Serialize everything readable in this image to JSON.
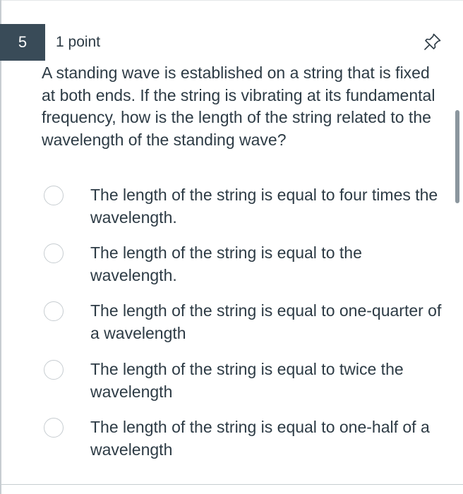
{
  "question": {
    "number": "5",
    "points": "1 point",
    "text": "A standing wave is established on a string that is fixed at both ends. If the string is vibrating at its fundamental frequency, how is the length of the string related to the wavelength of the standing wave?",
    "pin_icon": "pin-icon",
    "answers": [
      {
        "label": "The length of the string is equal to four times the wavelength.",
        "selected": false
      },
      {
        "label": "The length of the string is equal to the wavelength.",
        "selected": false
      },
      {
        "label": "The length of the string is equal to one-quarter of a wavelength",
        "selected": false
      },
      {
        "label": "The length of the string is equal to twice the wavelength",
        "selected": false
      },
      {
        "label": "The length of the string is equal to one-half of a wavelength",
        "selected": false
      }
    ]
  },
  "colors": {
    "number_badge_bg": "#394b58",
    "text": "#2d3b45",
    "radio_border": "#c7cdd1"
  }
}
